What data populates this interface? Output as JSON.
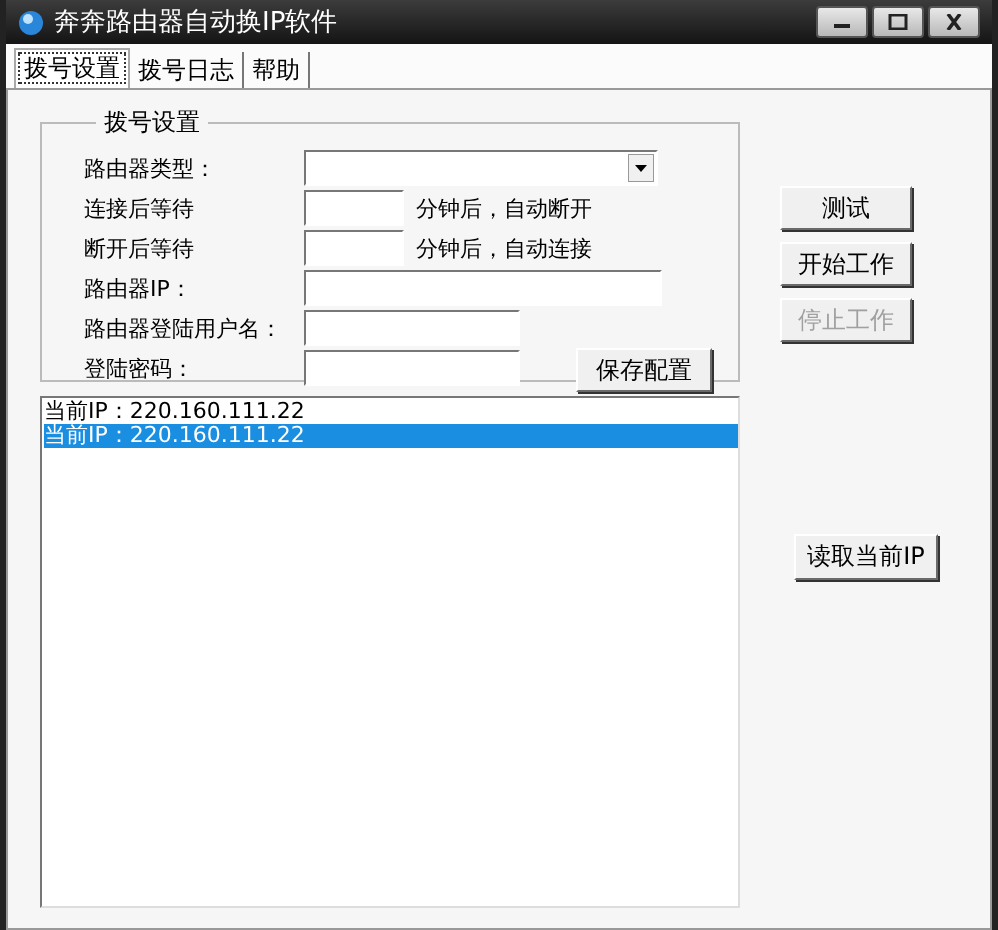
{
  "window": {
    "title": "奔奔路由器自动换IP软件"
  },
  "tabs": [
    {
      "label": "拨号设置",
      "selected": true
    },
    {
      "label": "拨号日志",
      "selected": false
    },
    {
      "label": "帮助",
      "selected": false
    }
  ],
  "group": {
    "title": "拨号设置",
    "fields": [
      {
        "kind": "combo",
        "label": "路由器类型："
      },
      {
        "kind": "minutes",
        "label": "连接后等待",
        "suffix": "分钟后，自动断开"
      },
      {
        "kind": "minutes",
        "label": "断开后等待",
        "suffix": "分钟后，自动连接"
      },
      {
        "kind": "wide",
        "label": "路由器IP："
      },
      {
        "kind": "short",
        "label": "路由器登陆用户名："
      },
      {
        "kind": "short",
        "label": "登陆密码："
      }
    ],
    "save_button": "保存配置"
  },
  "log": [
    {
      "text": "当前IP：220.160.111.22",
      "selected": false
    },
    {
      "text": "当前IP：220.160.111.22",
      "selected": true
    }
  ],
  "buttons": [
    {
      "label": "测试",
      "disabled": false
    },
    {
      "label": "开始工作",
      "disabled": false
    },
    {
      "label": "停止工作",
      "disabled": true
    }
  ],
  "read_ip_button": "读取当前IP"
}
